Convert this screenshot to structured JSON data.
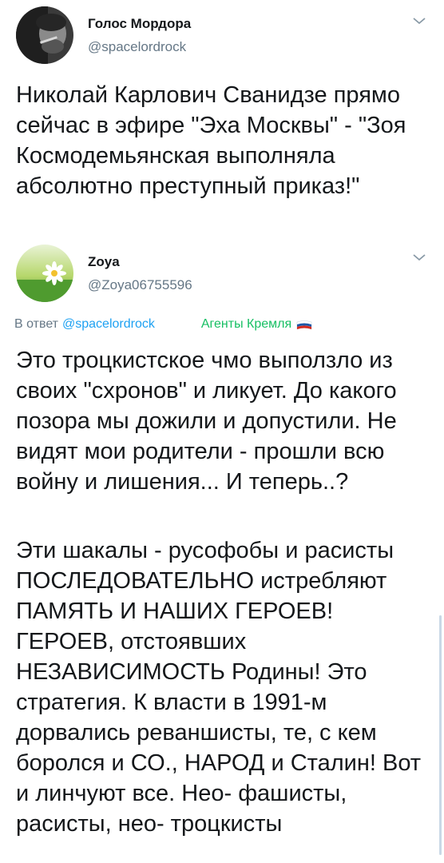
{
  "tweet1": {
    "author_name": "Голос Мордора",
    "author_handle": "@spacelordrock",
    "text": "Николай Карлович Сванидзе прямо сейчас в эфире \"Эха Москвы\" - \"Зоя Космодемьянская выполняла абсолютно преступный приказ!\""
  },
  "tweet2": {
    "author_name": "Zoya",
    "author_handle": "@Zoya06755596",
    "reply_prefix": "В ответ",
    "reply_to": "@spacelordrock",
    "tag": "Агенты Кремля",
    "paragraph1": "Это троцкистское чмо выползло из своих \"схронов\" и ликует. До какого позора мы дожили и допустили. Не видят мои родители - прошли всю войну и лишения... И теперь..?",
    "paragraph2": "Эти шакалы - русофобы и расисты ПОСЛЕДОВАТЕЛЬНО истребляют ПАМЯТЬ И НАШИХ ГЕРОЕВ! ГЕРОЕВ, отстоявших НЕЗАВИСИМОСТЬ Родины! Это стратегия. К власти  в 1991-м дорвались реваншисты, те, с кем боролся и СО., НАРОД и Сталин! Вот и линчуют все. Нео- фашисты, расисты, нео- троцкисты"
  },
  "icons": {
    "menu": "chevron-down-icon",
    "flag": "russia-flag-icon"
  },
  "colors": {
    "link": "#1da1f2",
    "secondary": "#657786",
    "tag": "#17bf63"
  }
}
